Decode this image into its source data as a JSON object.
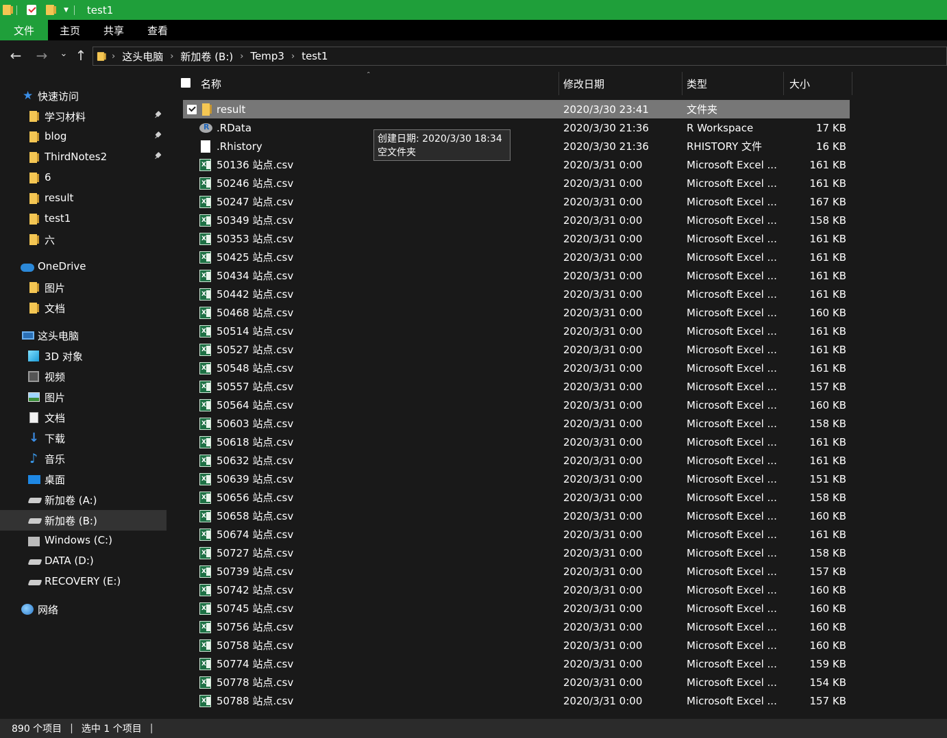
{
  "window": {
    "title": "test1"
  },
  "ribbon": {
    "tabs": [
      "文件",
      "主页",
      "共享",
      "查看"
    ]
  },
  "address": {
    "crumbs": [
      "这头电脑",
      "新加卷 (B:)",
      "Temp3",
      "test1"
    ]
  },
  "sidebar": {
    "items": [
      {
        "label": "快速访问",
        "icon": "star-icon",
        "pinned": false
      },
      {
        "label": "学习材料",
        "icon": "folder-icon",
        "pinned": true
      },
      {
        "label": "blog",
        "icon": "folder-icon",
        "pinned": true
      },
      {
        "label": "ThirdNotes2",
        "icon": "folder-icon",
        "pinned": true
      },
      {
        "label": "6",
        "icon": "folder-icon",
        "pinned": false
      },
      {
        "label": "result",
        "icon": "folder-icon",
        "pinned": false
      },
      {
        "label": "test1",
        "icon": "folder-icon",
        "pinned": false
      },
      {
        "label": "六",
        "icon": "folder-icon",
        "pinned": false
      },
      {
        "label": "OneDrive",
        "icon": "cloud-icon",
        "pinned": false
      },
      {
        "label": "图片",
        "icon": "folder-icon",
        "pinned": false
      },
      {
        "label": "文档",
        "icon": "folder-icon",
        "pinned": false
      },
      {
        "label": "这头电脑",
        "icon": "computer-icon",
        "pinned": false
      },
      {
        "label": "3D 对象",
        "icon": "cube-icon",
        "pinned": false
      },
      {
        "label": "视频",
        "icon": "video-icon",
        "pinned": false
      },
      {
        "label": "图片",
        "icon": "picture-icon",
        "pinned": false
      },
      {
        "label": "文档",
        "icon": "document-icon",
        "pinned": false
      },
      {
        "label": "下载",
        "icon": "download-icon",
        "pinned": false
      },
      {
        "label": "音乐",
        "icon": "music-icon",
        "pinned": false
      },
      {
        "label": "桌面",
        "icon": "desktop-icon",
        "pinned": false
      },
      {
        "label": "新加卷 (A:)",
        "icon": "drive-icon",
        "pinned": false
      },
      {
        "label": "新加卷 (B:)",
        "icon": "drive-icon",
        "pinned": false,
        "selected": true
      },
      {
        "label": "Windows (C:)",
        "icon": "windows-drive-icon",
        "pinned": false
      },
      {
        "label": "DATA (D:)",
        "icon": "drive-icon",
        "pinned": false
      },
      {
        "label": "RECOVERY (E:)",
        "icon": "drive-icon",
        "pinned": false
      },
      {
        "label": "网络",
        "icon": "network-icon",
        "pinned": false
      }
    ]
  },
  "columns": {
    "name": "名称",
    "date": "修改日期",
    "type": "类型",
    "size": "大小"
  },
  "files": [
    {
      "name": "result",
      "date": "2020/3/30 23:41",
      "type": "文件夹",
      "size": "",
      "icon": "folder-icon",
      "selected": true
    },
    {
      "name": ".RData",
      "date": "2020/3/30 21:36",
      "type": "R Workspace",
      "size": "17 KB",
      "icon": "r-workspace-icon"
    },
    {
      "name": ".Rhistory",
      "date": "2020/3/30 21:36",
      "type": "RHISTORY 文件",
      "size": "16 KB",
      "icon": "blank-file-icon"
    },
    {
      "name": "50136 站点.csv",
      "date": "2020/3/31 0:00",
      "type": "Microsoft Excel ...",
      "size": "161 KB",
      "icon": "excel-icon"
    },
    {
      "name": "50246 站点.csv",
      "date": "2020/3/31 0:00",
      "type": "Microsoft Excel ...",
      "size": "161 KB",
      "icon": "excel-icon"
    },
    {
      "name": "50247 站点.csv",
      "date": "2020/3/31 0:00",
      "type": "Microsoft Excel ...",
      "size": "167 KB",
      "icon": "excel-icon"
    },
    {
      "name": "50349 站点.csv",
      "date": "2020/3/31 0:00",
      "type": "Microsoft Excel ...",
      "size": "158 KB",
      "icon": "excel-icon"
    },
    {
      "name": "50353 站点.csv",
      "date": "2020/3/31 0:00",
      "type": "Microsoft Excel ...",
      "size": "161 KB",
      "icon": "excel-icon"
    },
    {
      "name": "50425 站点.csv",
      "date": "2020/3/31 0:00",
      "type": "Microsoft Excel ...",
      "size": "161 KB",
      "icon": "excel-icon"
    },
    {
      "name": "50434 站点.csv",
      "date": "2020/3/31 0:00",
      "type": "Microsoft Excel ...",
      "size": "161 KB",
      "icon": "excel-icon"
    },
    {
      "name": "50442 站点.csv",
      "date": "2020/3/31 0:00",
      "type": "Microsoft Excel ...",
      "size": "161 KB",
      "icon": "excel-icon"
    },
    {
      "name": "50468 站点.csv",
      "date": "2020/3/31 0:00",
      "type": "Microsoft Excel ...",
      "size": "160 KB",
      "icon": "excel-icon"
    },
    {
      "name": "50514 站点.csv",
      "date": "2020/3/31 0:00",
      "type": "Microsoft Excel ...",
      "size": "161 KB",
      "icon": "excel-icon"
    },
    {
      "name": "50527 站点.csv",
      "date": "2020/3/31 0:00",
      "type": "Microsoft Excel ...",
      "size": "161 KB",
      "icon": "excel-icon"
    },
    {
      "name": "50548 站点.csv",
      "date": "2020/3/31 0:00",
      "type": "Microsoft Excel ...",
      "size": "161 KB",
      "icon": "excel-icon"
    },
    {
      "name": "50557 站点.csv",
      "date": "2020/3/31 0:00",
      "type": "Microsoft Excel ...",
      "size": "157 KB",
      "icon": "excel-icon"
    },
    {
      "name": "50564 站点.csv",
      "date": "2020/3/31 0:00",
      "type": "Microsoft Excel ...",
      "size": "160 KB",
      "icon": "excel-icon"
    },
    {
      "name": "50603 站点.csv",
      "date": "2020/3/31 0:00",
      "type": "Microsoft Excel ...",
      "size": "158 KB",
      "icon": "excel-icon"
    },
    {
      "name": "50618 站点.csv",
      "date": "2020/3/31 0:00",
      "type": "Microsoft Excel ...",
      "size": "161 KB",
      "icon": "excel-icon"
    },
    {
      "name": "50632 站点.csv",
      "date": "2020/3/31 0:00",
      "type": "Microsoft Excel ...",
      "size": "161 KB",
      "icon": "excel-icon"
    },
    {
      "name": "50639 站点.csv",
      "date": "2020/3/31 0:00",
      "type": "Microsoft Excel ...",
      "size": "151 KB",
      "icon": "excel-icon"
    },
    {
      "name": "50656 站点.csv",
      "date": "2020/3/31 0:00",
      "type": "Microsoft Excel ...",
      "size": "158 KB",
      "icon": "excel-icon"
    },
    {
      "name": "50658 站点.csv",
      "date": "2020/3/31 0:00",
      "type": "Microsoft Excel ...",
      "size": "160 KB",
      "icon": "excel-icon"
    },
    {
      "name": "50674 站点.csv",
      "date": "2020/3/31 0:00",
      "type": "Microsoft Excel ...",
      "size": "161 KB",
      "icon": "excel-icon"
    },
    {
      "name": "50727 站点.csv",
      "date": "2020/3/31 0:00",
      "type": "Microsoft Excel ...",
      "size": "158 KB",
      "icon": "excel-icon"
    },
    {
      "name": "50739 站点.csv",
      "date": "2020/3/31 0:00",
      "type": "Microsoft Excel ...",
      "size": "157 KB",
      "icon": "excel-icon"
    },
    {
      "name": "50742 站点.csv",
      "date": "2020/3/31 0:00",
      "type": "Microsoft Excel ...",
      "size": "160 KB",
      "icon": "excel-icon"
    },
    {
      "name": "50745 站点.csv",
      "date": "2020/3/31 0:00",
      "type": "Microsoft Excel ...",
      "size": "160 KB",
      "icon": "excel-icon"
    },
    {
      "name": "50756 站点.csv",
      "date": "2020/3/31 0:00",
      "type": "Microsoft Excel ...",
      "size": "160 KB",
      "icon": "excel-icon"
    },
    {
      "name": "50758 站点.csv",
      "date": "2020/3/31 0:00",
      "type": "Microsoft Excel ...",
      "size": "160 KB",
      "icon": "excel-icon"
    },
    {
      "name": "50774 站点.csv",
      "date": "2020/3/31 0:00",
      "type": "Microsoft Excel ...",
      "size": "159 KB",
      "icon": "excel-icon"
    },
    {
      "name": "50778 站点.csv",
      "date": "2020/3/31 0:00",
      "type": "Microsoft Excel ...",
      "size": "154 KB",
      "icon": "excel-icon"
    },
    {
      "name": "50788 站点.csv",
      "date": "2020/3/31 0:00",
      "type": "Microsoft Excel ...",
      "size": "157 KB",
      "icon": "excel-icon"
    }
  ],
  "tooltip": {
    "line1": "创建日期: 2020/3/30 18:34",
    "line2": "空文件夹"
  },
  "status": {
    "count": "890 个项目",
    "selected": "选中 1 个项目"
  },
  "colors": {
    "accent": "#1f9f3a",
    "selected_row": "#777777",
    "background": "#191919"
  }
}
